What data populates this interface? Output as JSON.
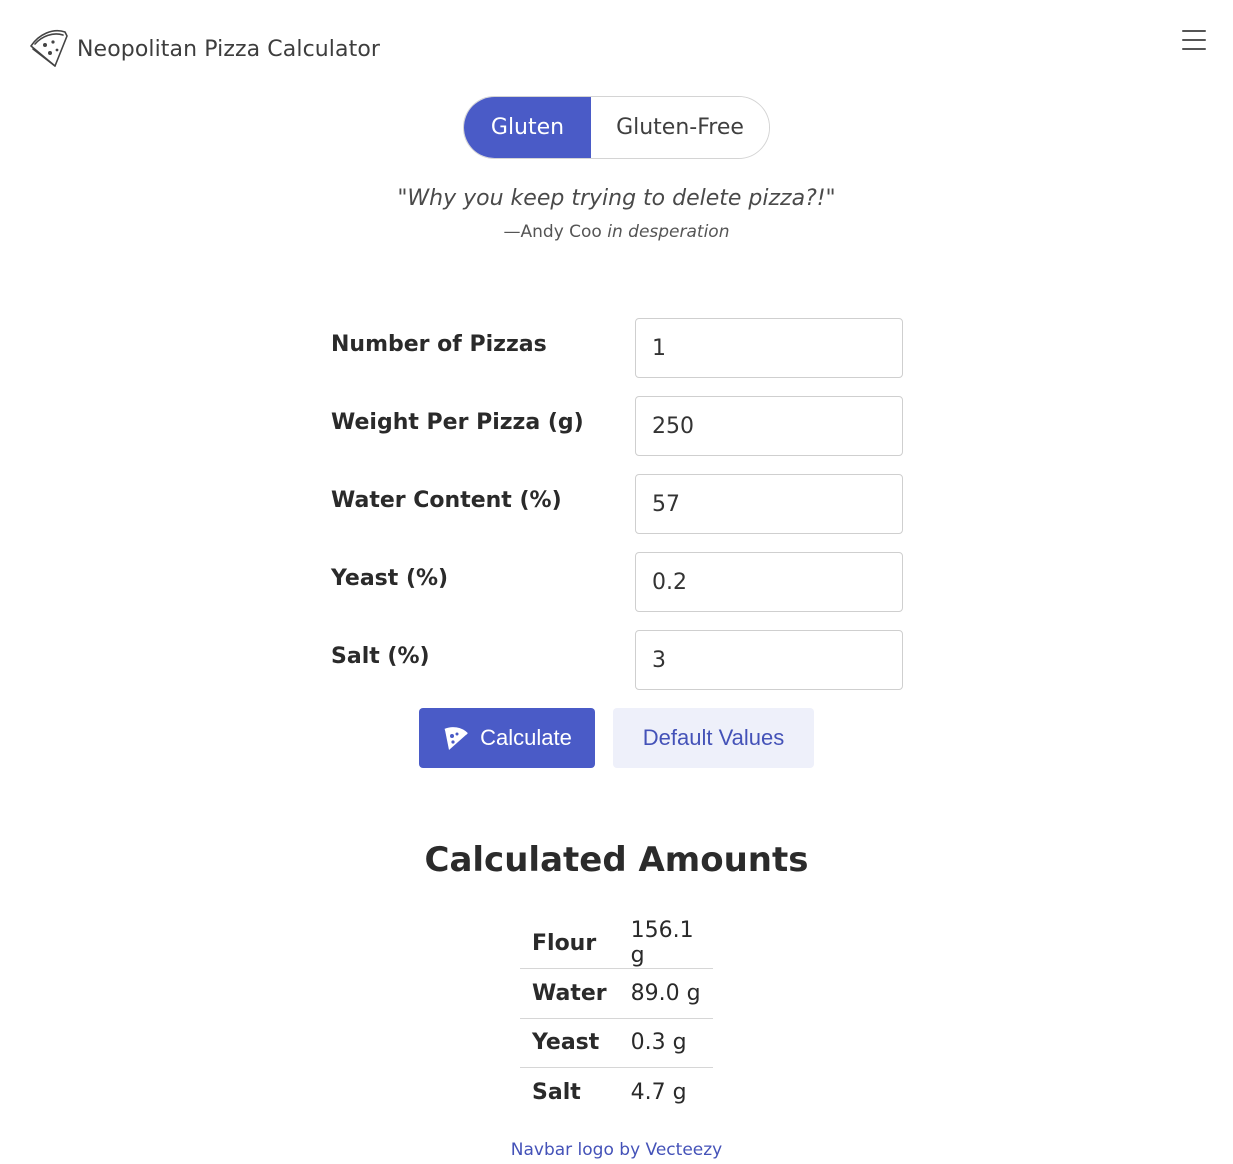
{
  "navbar": {
    "title": "Neopolitan Pizza Calculator",
    "logo_icon": "pizza-slice-icon",
    "menu_icon": "hamburger-menu-icon"
  },
  "mode_toggle": {
    "options": [
      "Gluten",
      "Gluten-Free"
    ],
    "selected": "Gluten",
    "accent_color": "#4a5bc7"
  },
  "quote": {
    "text": "\"Why you keep trying to delete pizza?!\"",
    "author": "—Andy Coo",
    "context": "in desperation"
  },
  "form": {
    "fields": [
      {
        "label": "Number of Pizzas",
        "value": "1"
      },
      {
        "label": "Weight Per Pizza (g)",
        "value": "250"
      },
      {
        "label": "Water Content (%)",
        "value": "57"
      },
      {
        "label": "Yeast (%)",
        "value": "0.2"
      },
      {
        "label": "Salt (%)",
        "value": "3"
      }
    ],
    "calculate_label": "Calculate",
    "calculate_icon": "pizza-slice-icon",
    "default_label": "Default Values"
  },
  "results": {
    "title": "Calculated Amounts",
    "rows": [
      {
        "label": "Flour",
        "value": "156.1 g"
      },
      {
        "label": "Water",
        "value": "89.0 g"
      },
      {
        "label": "Yeast",
        "value": "0.3 g"
      },
      {
        "label": "Salt",
        "value": "4.7 g"
      }
    ]
  },
  "footer": {
    "credit": "Navbar logo by Vecteezy"
  }
}
